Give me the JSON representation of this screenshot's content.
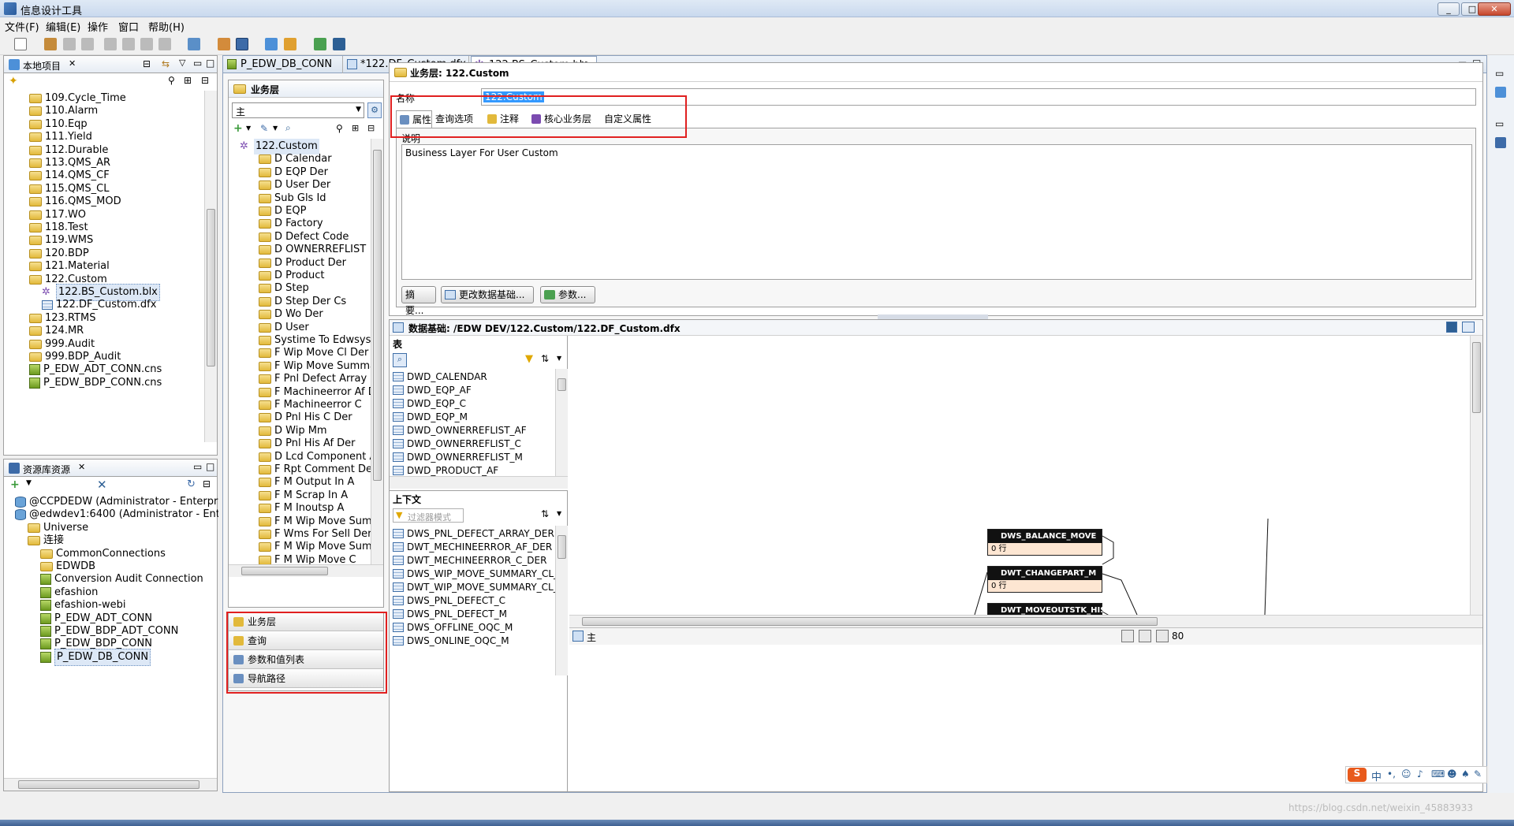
{
  "window": {
    "title": "信息设计工具",
    "min": "_",
    "max": "□",
    "close": "✕"
  },
  "menu": [
    "文件(F)",
    "编辑(E)",
    "操作",
    "窗口",
    "帮助(H)"
  ],
  "local_project": {
    "tab": "本地项目",
    "items": [
      {
        "label": "109.Cycle_Time",
        "type": "folder",
        "indent": 1
      },
      {
        "label": "110.Alarm",
        "type": "folder",
        "indent": 1
      },
      {
        "label": "110.Eqp",
        "type": "folder",
        "indent": 1
      },
      {
        "label": "111.Yield",
        "type": "folder",
        "indent": 1
      },
      {
        "label": "112.Durable",
        "type": "folder",
        "indent": 1
      },
      {
        "label": "113.QMS_AR",
        "type": "folder",
        "indent": 1
      },
      {
        "label": "114.QMS_CF",
        "type": "folder",
        "indent": 1
      },
      {
        "label": "115.QMS_CL",
        "type": "folder",
        "indent": 1
      },
      {
        "label": "116.QMS_MOD",
        "type": "folder",
        "indent": 1
      },
      {
        "label": "117.WO",
        "type": "folder",
        "indent": 1
      },
      {
        "label": "118.Test",
        "type": "folder",
        "indent": 1
      },
      {
        "label": "119.WMS",
        "type": "folder",
        "indent": 1
      },
      {
        "label": "120.BDP",
        "type": "folder",
        "indent": 1
      },
      {
        "label": "121.Material",
        "type": "folder",
        "indent": 1
      },
      {
        "label": "122.Custom",
        "type": "folder",
        "indent": 1
      },
      {
        "label": "122.BS_Custom.blx",
        "type": "blx",
        "indent": 2,
        "selected": true
      },
      {
        "label": "122.DF_Custom.dfx",
        "type": "dfx",
        "indent": 2
      },
      {
        "label": "123.RTMS",
        "type": "folder",
        "indent": 1
      },
      {
        "label": "124.MR",
        "type": "folder",
        "indent": 1
      },
      {
        "label": "999.Audit",
        "type": "folder",
        "indent": 1
      },
      {
        "label": "999.BDP_Audit",
        "type": "folder",
        "indent": 1
      },
      {
        "label": "P_EDW_ADT_CONN.cns",
        "type": "conn",
        "indent": 1
      },
      {
        "label": "P_EDW_BDP_CONN.cns",
        "type": "conn",
        "indent": 1
      }
    ]
  },
  "repo": {
    "tab": "资源库资源",
    "items": [
      {
        "label": "@CCPDEDW (Administrator - Enterpris",
        "type": "db",
        "indent": 0
      },
      {
        "label": "@edwdev1:6400 (Administrator - Enter",
        "type": "db",
        "indent": 0
      },
      {
        "label": "Universe",
        "type": "folder",
        "indent": 1
      },
      {
        "label": "连接",
        "type": "folder",
        "indent": 1
      },
      {
        "label": "CommonConnections",
        "type": "folder",
        "indent": 2
      },
      {
        "label": "EDWDB",
        "type": "folder",
        "indent": 2
      },
      {
        "label": "Conversion Audit Connection",
        "type": "conn",
        "indent": 2
      },
      {
        "label": "efashion",
        "type": "conn",
        "indent": 2
      },
      {
        "label": "efashion-webi",
        "type": "conn",
        "indent": 2
      },
      {
        "label": "P_EDW_ADT_CONN",
        "type": "conn",
        "indent": 2
      },
      {
        "label": "P_EDW_BDP_ADT_CONN",
        "type": "conn",
        "indent": 2
      },
      {
        "label": "P_EDW_BDP_CONN",
        "type": "conn",
        "indent": 2
      },
      {
        "label": "P_EDW_DB_CONN",
        "type": "conn",
        "indent": 2,
        "selected": true
      }
    ]
  },
  "editor_tabs": [
    {
      "label": "P_EDW_DB_CONN",
      "active": false
    },
    {
      "label": "*122.DF_Custom.dfx",
      "active": false
    },
    {
      "label": "122.BS_Custom.blx",
      "active": true
    }
  ],
  "business_layer": {
    "header": "业务层",
    "combo": "主",
    "root": "122.Custom",
    "folders": [
      "D Calendar",
      "D EQP Der",
      "D User Der",
      "Sub Gls Id",
      "D EQP",
      "D Factory",
      "D Defect Code",
      "D OWNERREFLIST",
      "D Product Der",
      "D Product",
      "D Step",
      "D Step Der Cs",
      "D Wo Der",
      "D User",
      "Systime To Edwsys",
      "F Wip Move Cl Der",
      "F Wip Move Summar",
      "F Pnl Defect Array De",
      "F Machineerror Af De",
      "F Machineerror C",
      "D Pnl His C Der",
      "D Wip Mm",
      "D Pnl His Af Der",
      "D Lcd Component Af",
      "F Rpt Comment Der",
      "F M Output In A",
      "F M Scrap In A",
      "F M Inoutsp A",
      "F M Wip Move Summ",
      "F Wms For Sell Der",
      "F M Wip Move Summ",
      "F M Wip Move C"
    ],
    "bottom_nav": [
      "业务层",
      "查询",
      "参数和值列表",
      "导航路径"
    ]
  },
  "props": {
    "title": "业务层: 122.Custom",
    "name_label": "名称",
    "name_value": "122.Custom",
    "tabs": [
      "属性",
      "查询选项",
      "注释",
      "核心业务层",
      "自定义属性"
    ],
    "desc_label": "说明",
    "desc_value": "Business Layer For User Custom",
    "buttons": [
      "摘要...",
      "更改数据基础...",
      "参数..."
    ]
  },
  "data_foundation": {
    "title": "数据基础: /EDW DEV/122.Custom/122.DF_Custom.dfx",
    "tables_header": "表",
    "tables": [
      "DWD_CALENDAR",
      "DWD_EQP_AF",
      "DWD_EQP_C",
      "DWD_EQP_M",
      "DWD_OWNERREFLIST_AF",
      "DWD_OWNERREFLIST_C",
      "DWD_OWNERREFLIST_M",
      "DWD_PRODUCT_AF"
    ],
    "context_header": "上下文",
    "filter_placeholder": "过滤器模式",
    "context_items": [
      "DWS_PNL_DEFECT_ARRAY_DER",
      "DWT_MECHINEERROR_AF_DER",
      "DWT_MECHINEERROR_C_DER",
      "DWS_WIP_MOVE_SUMMARY_CL_DER",
      "DWT_WIP_MOVE_SUMMARY_CL_DER",
      "DWS_PNL_DEFECT_C",
      "DWS_PNL_DEFECT_M",
      "DWS_OFFLINE_OQC_M",
      "DWS_ONLINE_OQC_M"
    ],
    "boxes": [
      {
        "name": "DWS_BALANCE_MOVE",
        "rows": "0 行"
      },
      {
        "name": "DWT_CHANGEPART_M",
        "rows": "0 行"
      },
      {
        "name": "DWT_MOVEOUTSTK_HIS_M",
        "rows": ""
      }
    ],
    "bottom_tab": "主",
    "zoom": "80"
  },
  "ime": {
    "label": "S",
    "lang": "中"
  },
  "watermark": "https://blog.csdn.net/weixin_45883933",
  "colors": {
    "highlight": "#e02020",
    "selection": "#3399ff"
  }
}
